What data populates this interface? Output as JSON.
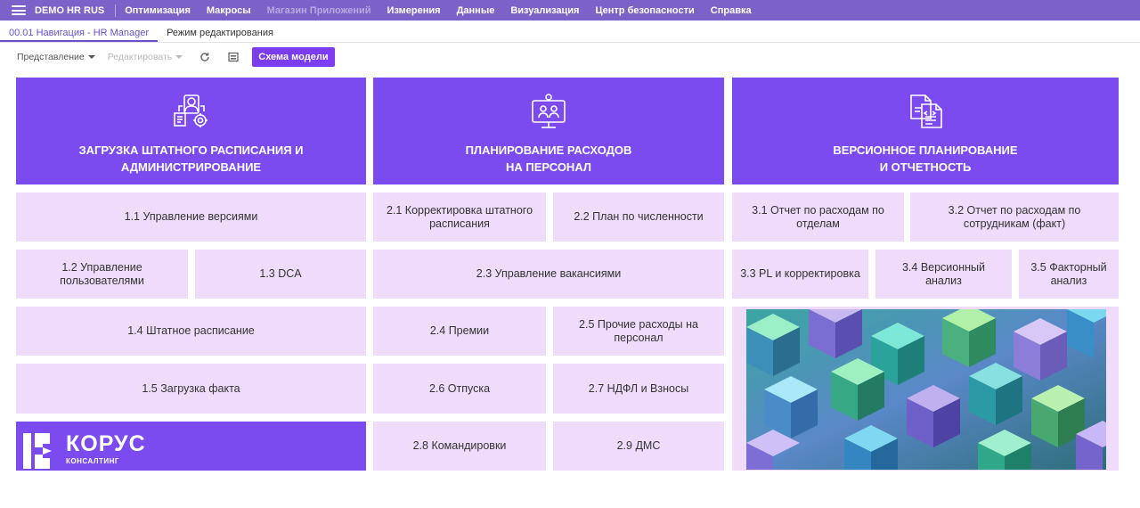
{
  "app": {
    "name": "DEMO HR RUS"
  },
  "menu": [
    {
      "label": "Оптимизация",
      "disabled": false
    },
    {
      "label": "Макросы",
      "disabled": false
    },
    {
      "label": "Магазин Приложений",
      "disabled": true
    },
    {
      "label": "Измерения",
      "disabled": false
    },
    {
      "label": "Данные",
      "disabled": false
    },
    {
      "label": "Визуализация",
      "disabled": false
    },
    {
      "label": "Центр безопасности",
      "disabled": false
    },
    {
      "label": "Справка",
      "disabled": false
    }
  ],
  "tabs": [
    {
      "label": "00.01 Навигация - HR Manager",
      "active": true
    },
    {
      "label": "Режим редактирования",
      "active": false
    }
  ],
  "toolbar": {
    "view_label": "Представление",
    "edit_label": "Редактировать",
    "refresh_icon": "refresh-icon",
    "print_icon": "print-icon",
    "model_button": "Схема модели"
  },
  "sections": {
    "s1": {
      "title": "ЗАГРУЗКА ШТАТНОГО РАСПИСАНИЯ И\nАДМИНИСТРИРОВАНИЕ",
      "icon": "staff-admin-icon"
    },
    "s2": {
      "title": "ПЛАНИРОВАНИЕ РАСХОДОВ\nНА ПЕРСОНАЛ",
      "icon": "presentation-icon"
    },
    "s3": {
      "title": "ВЕРСИОННОЕ ПЛАНИРОВАНИЕ\nИ ОТЧЕТНОСТЬ",
      "icon": "document-versions-icon"
    }
  },
  "tiles": {
    "t11": "1.1 Управление версиями",
    "t12": "1.2 Управление пользователями",
    "t13": "1.3 DCA",
    "t14": "1.4 Штатное расписание",
    "t15": "1.5 Загрузка факта",
    "t21": "2.1 Корректировка штатного расписания",
    "t22": "2.2 План по численности",
    "t23": "2.3 Управление вакансиями",
    "t24": "2.4 Премии",
    "t25": "2.5 Прочие расходы на персонал",
    "t26": "2.6 Отпуска",
    "t27": "2.7 НДФЛ и Взносы",
    "t28": "2.8 Командировки",
    "t29": "2.9 ДМС",
    "t31": "3.1 Отчет по расходам по отделам",
    "t32": "3.2 Отчет по расходам по сотрудникам (факт)",
    "t33": "3.3 PL и корректировка",
    "t34": "3.4 Версионный анализ",
    "t35": "3.5 Факторный анализ"
  },
  "logo": {
    "name": "КОРУС",
    "sub": "КОНСАЛТИНГ"
  },
  "colors": {
    "topbar": "#7c62c8",
    "header": "#7c4bf0",
    "tile": "#efdcfb",
    "button": "#7c3cf0"
  }
}
